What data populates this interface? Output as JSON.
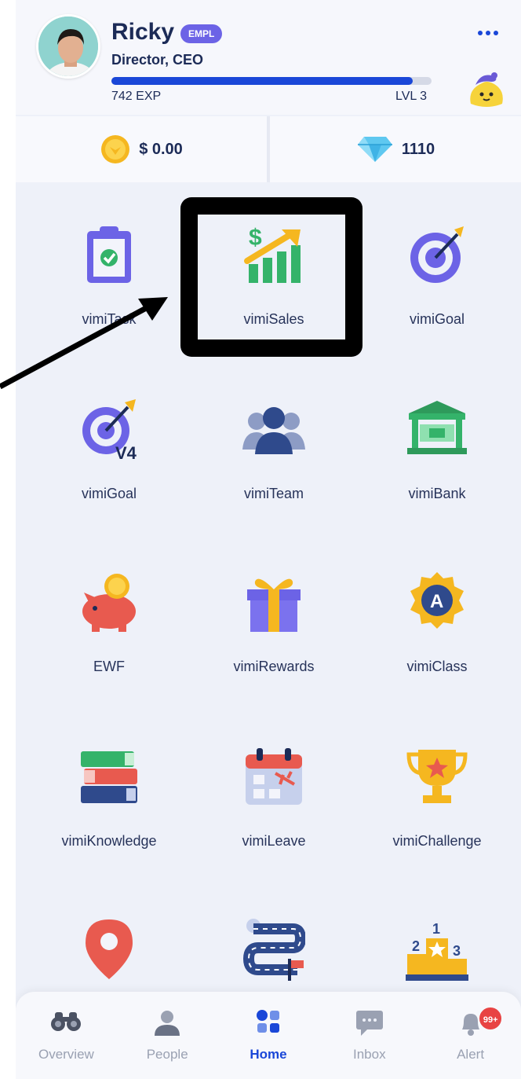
{
  "profile": {
    "name": "Ricky",
    "badge": "EMPL",
    "role": "Director, CEO",
    "exp": "742 EXP",
    "level": "LVL 3",
    "xp_progress": 0.94,
    "more_icon": "more-dots-icon",
    "mascot_icon": "mascot-icon"
  },
  "balance": {
    "coins": "$ 0.00",
    "coin_icon": "coin-icon",
    "gems": "1110",
    "gem_icon": "diamond-icon"
  },
  "apps": [
    {
      "label": "vimiTask",
      "icon": "clipboard-check-icon"
    },
    {
      "label": "vimiSales",
      "icon": "sales-growth-icon"
    },
    {
      "label": "vimiGoal",
      "icon": "target-icon"
    },
    {
      "label": "vimiGoal",
      "icon": "target-v4-icon",
      "sub": "V4"
    },
    {
      "label": "vimiTeam",
      "icon": "team-icon"
    },
    {
      "label": "vimiBank",
      "icon": "bank-icon"
    },
    {
      "label": "EWF",
      "icon": "piggy-bank-icon"
    },
    {
      "label": "vimiRewards",
      "icon": "gift-icon"
    },
    {
      "label": "vimiClass",
      "icon": "class-badge-icon",
      "sub": "A"
    },
    {
      "label": "vimiKnowledge",
      "icon": "books-icon"
    },
    {
      "label": "vimiLeave",
      "icon": "calendar-flight-icon"
    },
    {
      "label": "vimiChallenge",
      "icon": "trophy-icon"
    },
    {
      "label": "",
      "icon": "location-pin-icon"
    },
    {
      "label": "",
      "icon": "road-journey-icon"
    },
    {
      "label": "",
      "icon": "podium-icon",
      "sub": "1 2 3"
    }
  ],
  "nav": [
    {
      "label": "Overview",
      "icon": "binoculars-icon"
    },
    {
      "label": "People",
      "icon": "person-icon"
    },
    {
      "label": "Home",
      "icon": "home-grid-icon",
      "active": true
    },
    {
      "label": "Inbox",
      "icon": "chat-icon"
    },
    {
      "label": "Alert",
      "icon": "bell-icon",
      "badge": "99+"
    }
  ],
  "colors": {
    "accent": "#1a47d8",
    "badge": "#6c63e6",
    "background": "#eef1f9",
    "alert": "#e84343"
  }
}
